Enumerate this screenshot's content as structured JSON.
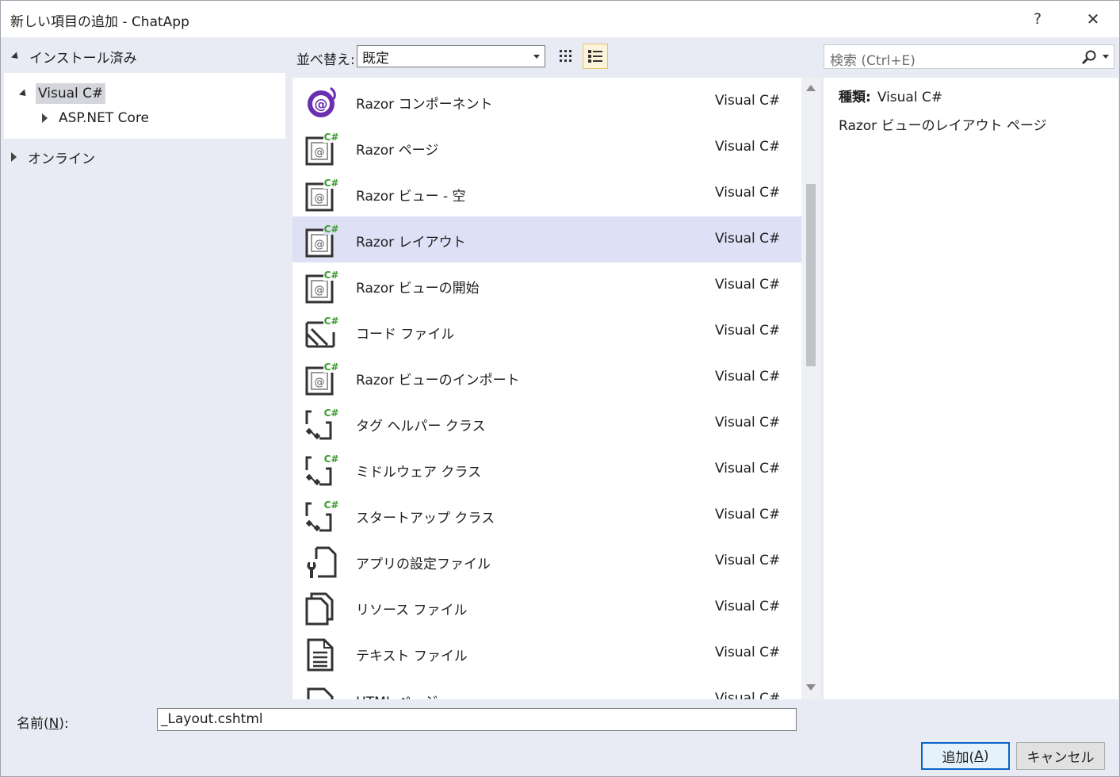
{
  "window": {
    "title": "新しい項目の追加 - ChatApp",
    "help_label": "?",
    "close_label": "✕"
  },
  "left_tree": {
    "installed_label": "インストール済み",
    "visual_csharp_label": "Visual C#",
    "aspnet_core_label": "ASP.NET Core",
    "online_label": "オンライン"
  },
  "toolbar": {
    "sort_label": "並べ替え:",
    "sort_value": "既定"
  },
  "search": {
    "placeholder": "検索 (Ctrl+E)"
  },
  "items": [
    {
      "name": "Razor コンポーネント",
      "lang": "Visual C#",
      "icon": "razor-component-icon"
    },
    {
      "name": "Razor ページ",
      "lang": "Visual C#",
      "icon": "razor-page-icon"
    },
    {
      "name": "Razor ビュー - 空",
      "lang": "Visual C#",
      "icon": "razor-view-icon"
    },
    {
      "name": "Razor レイアウト",
      "lang": "Visual C#",
      "icon": "razor-layout-icon",
      "selected": true
    },
    {
      "name": "Razor ビューの開始",
      "lang": "Visual C#",
      "icon": "razor-viewstart-icon"
    },
    {
      "name": "コード ファイル",
      "lang": "Visual C#",
      "icon": "code-file-icon"
    },
    {
      "name": "Razor ビューのインポート",
      "lang": "Visual C#",
      "icon": "razor-viewimports-icon"
    },
    {
      "name": "タグ ヘルパー クラス",
      "lang": "Visual C#",
      "icon": "class-icon"
    },
    {
      "name": "ミドルウェア クラス",
      "lang": "Visual C#",
      "icon": "class-icon"
    },
    {
      "name": "スタートアップ クラス",
      "lang": "Visual C#",
      "icon": "class-icon"
    },
    {
      "name": "アプリの設定ファイル",
      "lang": "Visual C#",
      "icon": "settings-file-icon"
    },
    {
      "name": "リソース ファイル",
      "lang": "Visual C#",
      "icon": "resource-file-icon"
    },
    {
      "name": "テキスト ファイル",
      "lang": "Visual C#",
      "icon": "text-file-icon"
    },
    {
      "name": "HTML ページ",
      "lang": "Visual C#",
      "icon": "html-page-icon"
    }
  ],
  "detail": {
    "kind_label": "種類:",
    "kind_value": "Visual C#",
    "description": "Razor ビューのレイアウト ページ"
  },
  "bottom": {
    "name_label_main": "名前(",
    "name_label_key": "N",
    "name_label_end": "):",
    "name_value": "_Layout.cshtml",
    "add_main": "追加(",
    "add_key": "A",
    "add_end": ")",
    "cancel_label": "キャンセル"
  },
  "colors": {
    "accent": "#0a64c8",
    "selected_row": "#dee0f6",
    "csharp_green": "#3a9a2e",
    "razor_purple": "#6b2fb0"
  }
}
